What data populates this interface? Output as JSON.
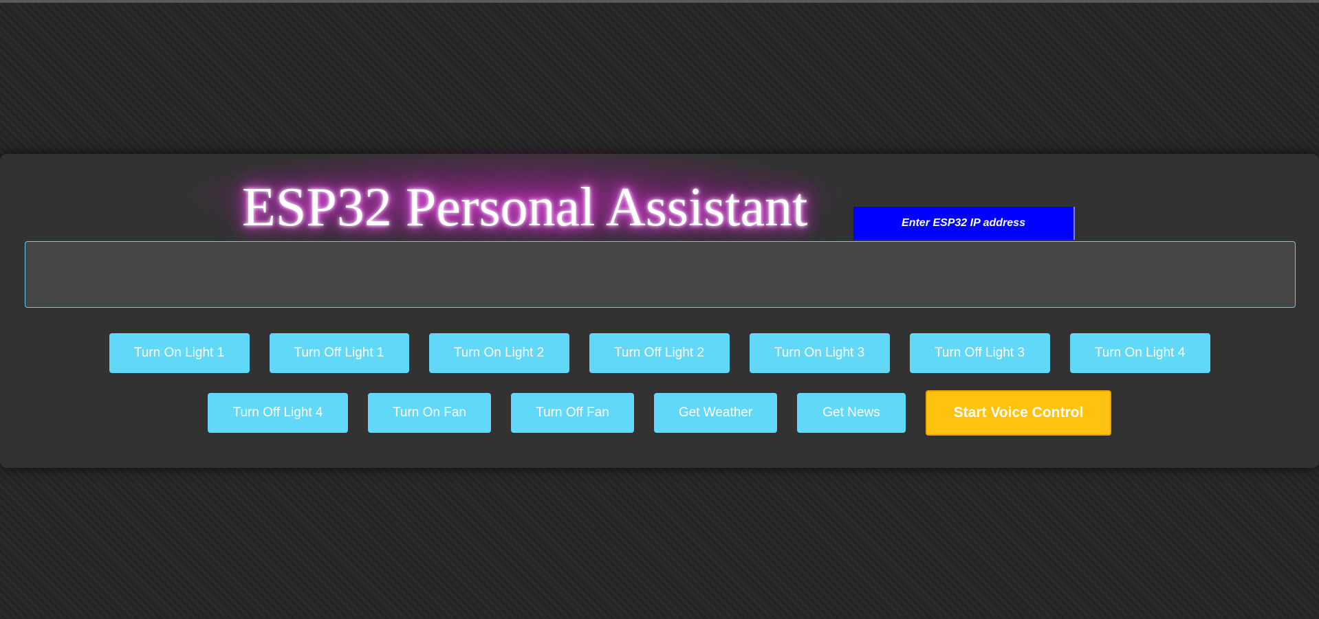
{
  "header": {
    "title": "ESP32 Personal Assistant"
  },
  "ip_input": {
    "placeholder": "Enter ESP32 IP address",
    "value": ""
  },
  "output": {
    "text": ""
  },
  "buttons": {
    "row1": [
      "Turn On Light 1",
      "Turn Off Light 1",
      "Turn On Light 2",
      "Turn Off Light 2",
      "Turn On Light 3",
      "Turn Off Light 3",
      "Turn On Light 4"
    ],
    "row2": [
      "Turn Off Light 4",
      "Turn On Fan",
      "Turn Off Fan",
      "Get Weather",
      "Get News"
    ],
    "voice_control": "Start Voice Control"
  },
  "colors": {
    "page_background": "#262626",
    "panel_background": "#323232",
    "title_glow": "#e040e0",
    "ip_input_background": "#0000ff",
    "output_border": "#5fd3f0",
    "command_button": "#62d8f8",
    "voice_button": "#ffc20e"
  }
}
